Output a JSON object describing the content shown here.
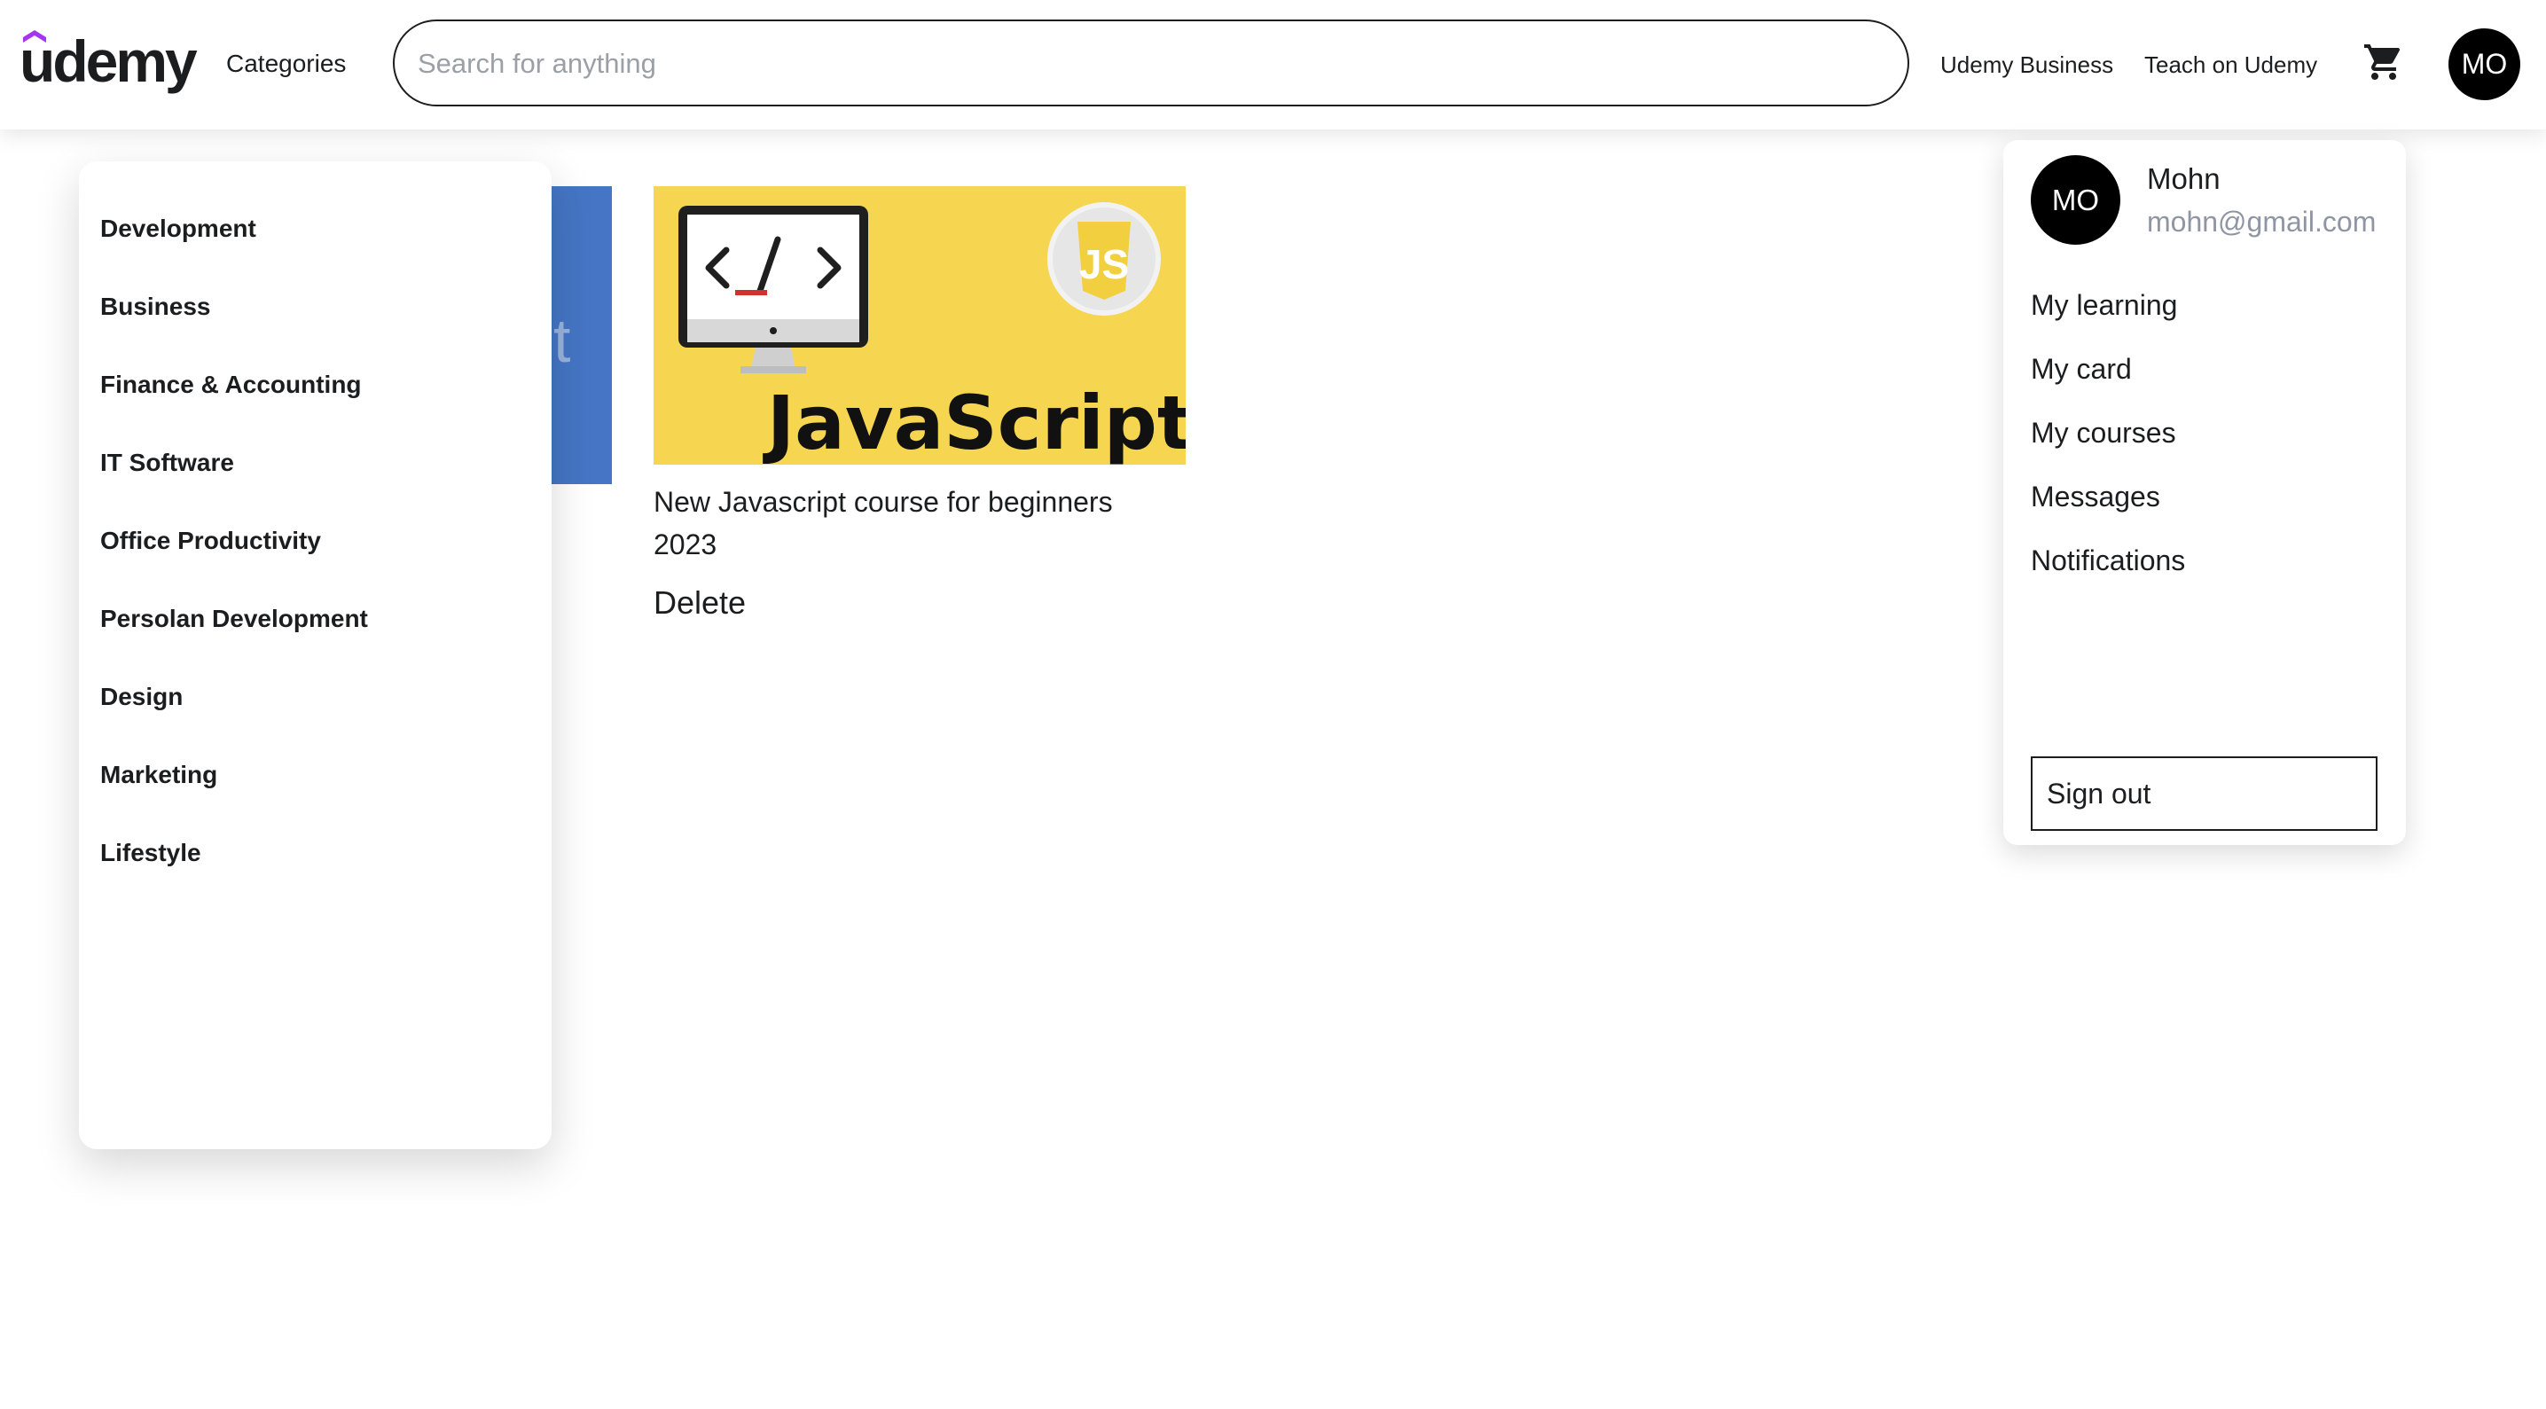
{
  "header": {
    "logo_text": "udemy",
    "categories_label": "Categories",
    "search_placeholder": "Search for anything",
    "business_link": "Udemy Business",
    "teach_link": "Teach on Udemy",
    "avatar_initials": "MO"
  },
  "categories_menu": {
    "items": [
      {
        "label": "Development"
      },
      {
        "label": "Business"
      },
      {
        "label": "Finance & Accounting"
      },
      {
        "label": "IT Software"
      },
      {
        "label": "Office Productivity"
      },
      {
        "label": "Persolan Development"
      },
      {
        "label": "Design"
      },
      {
        "label": "Marketing"
      },
      {
        "label": "Lifestyle"
      }
    ]
  },
  "course": {
    "thumbnail_text": "JavaScript",
    "badge_text": "JS",
    "code_symbol": "<_/>",
    "title": "New Javascript course for beginners 2023",
    "delete_label": "Delete"
  },
  "user_menu": {
    "initials": "MO",
    "name": "Mohn",
    "email": "mohn@gmail.com",
    "items": [
      {
        "label": "My learning"
      },
      {
        "label": "My card"
      },
      {
        "label": "My courses"
      },
      {
        "label": "Messages"
      },
      {
        "label": "Notifications"
      }
    ],
    "signout_label": "Sign out"
  },
  "colors": {
    "brand_purple": "#a435f0",
    "thumbnail_yellow": "#f6d650",
    "card_blue": "#4575c4",
    "email_gray": "#8f95a3"
  }
}
